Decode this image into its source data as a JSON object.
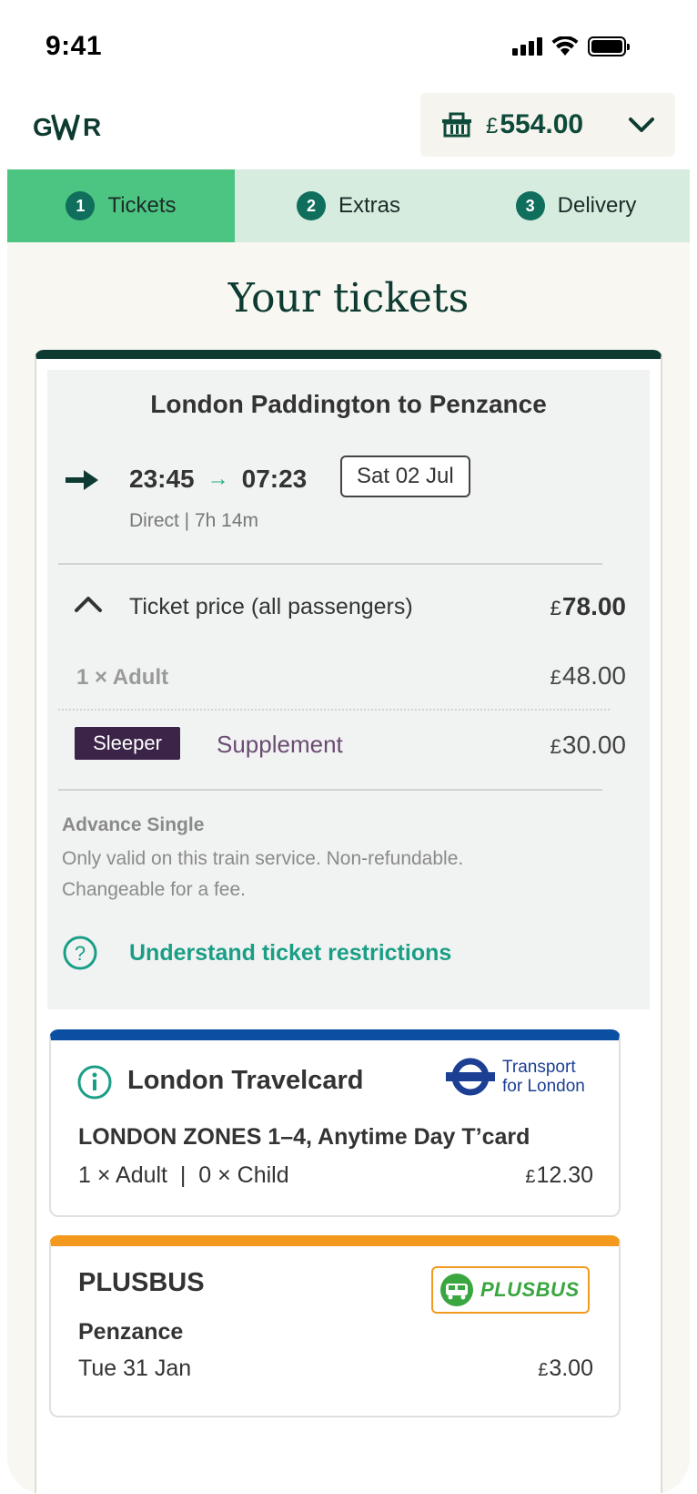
{
  "status_bar": {
    "time": "9:41"
  },
  "header": {
    "logo_text": "GWR",
    "basket": {
      "currency": "£",
      "amount": "554.00"
    }
  },
  "steps": [
    {
      "number": "1",
      "label": "Tickets",
      "active": true
    },
    {
      "number": "2",
      "label": "Extras",
      "active": false
    },
    {
      "number": "3",
      "label": "Delivery",
      "active": false
    }
  ],
  "page_title": "Your tickets",
  "journey": {
    "route": "London Paddington to Penzance",
    "depart": "23:45",
    "arrive": "07:23",
    "date": "Sat 02 Jul",
    "meta": "Direct | 7h 14m",
    "price_label": "Ticket price (all passengers)",
    "price_total_currency": "£",
    "price_total": "78.00",
    "adult_label": "1 × Adult",
    "adult_currency": "£",
    "adult_price": "48.00",
    "sleeper_badge": "Sleeper",
    "supplement_label": "Supplement",
    "supplement_currency": "£",
    "supplement_price": "30.00",
    "fare_type": "Advance Single",
    "fare_description": "Only valid on this train service. Non-refundable. Changeable for a fee.",
    "restrictions_link": "Understand ticket restrictions"
  },
  "travelcard": {
    "title": "London Travelcard",
    "tfl_line1": "Transport",
    "tfl_line2": "for London",
    "product": "LONDON ZONES 1–4, Anytime Day T’card",
    "passengers": "1 × Adult  |  0 × Child",
    "currency": "£",
    "price": "12.30",
    "accent_color": "#0b4fa3"
  },
  "plusbus": {
    "title": "PLUSBUS",
    "logo_text": "PLUSBUS",
    "place": "Penzance",
    "date": "Tue 31 Jan",
    "currency": "£",
    "price": "3.00",
    "accent_color": "#f39a1e"
  },
  "colors": {
    "brand_dark": "#0d3b31",
    "step_active": "#4cc482",
    "step_inactive": "#d5ecdf",
    "link": "#1a9e86",
    "sleeper": "#3b2447"
  }
}
